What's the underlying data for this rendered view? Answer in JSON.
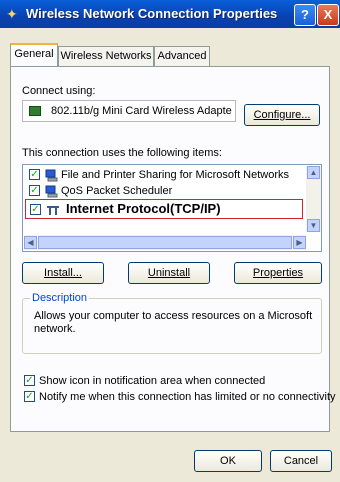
{
  "window": {
    "title": "Wireless Network Connection Properties",
    "help_label": "?",
    "close_label": "X"
  },
  "tabs": [
    {
      "label": "General"
    },
    {
      "label": "Wireless Networks"
    },
    {
      "label": "Advanced"
    }
  ],
  "general": {
    "connect_using_label": "Connect using:",
    "adapter_name": "802.11b/g Mini Card Wireless Adapte",
    "configure_label": "Configure...",
    "items_label": "This connection uses the following items:",
    "items": [
      {
        "label": "File and Printer Sharing for Microsoft Networks",
        "checked": true,
        "icon": "network-client-icon"
      },
      {
        "label": "QoS Packet Scheduler",
        "checked": true,
        "icon": "network-client-icon"
      },
      {
        "label": "Internet Protocol(TCP/IP)",
        "checked": true,
        "icon": "protocol-icon",
        "selected": true
      }
    ],
    "install_label": "Install...",
    "uninstall_label": "Uninstall",
    "properties_label": "Properties",
    "description_title": "Description",
    "description_text": "Allows your computer to access resources on a Microsoft network.",
    "show_icon_label": "Show icon in notification area when connected",
    "show_icon_checked": true,
    "notify_label": "Notify me when this connection has limited or no connectivity",
    "notify_checked": true
  },
  "footer": {
    "ok_label": "OK",
    "cancel_label": "Cancel"
  },
  "colors": {
    "titlebar": "#0842b0",
    "selection_highlight": "#d1242f",
    "description_title": "#0046d5"
  }
}
